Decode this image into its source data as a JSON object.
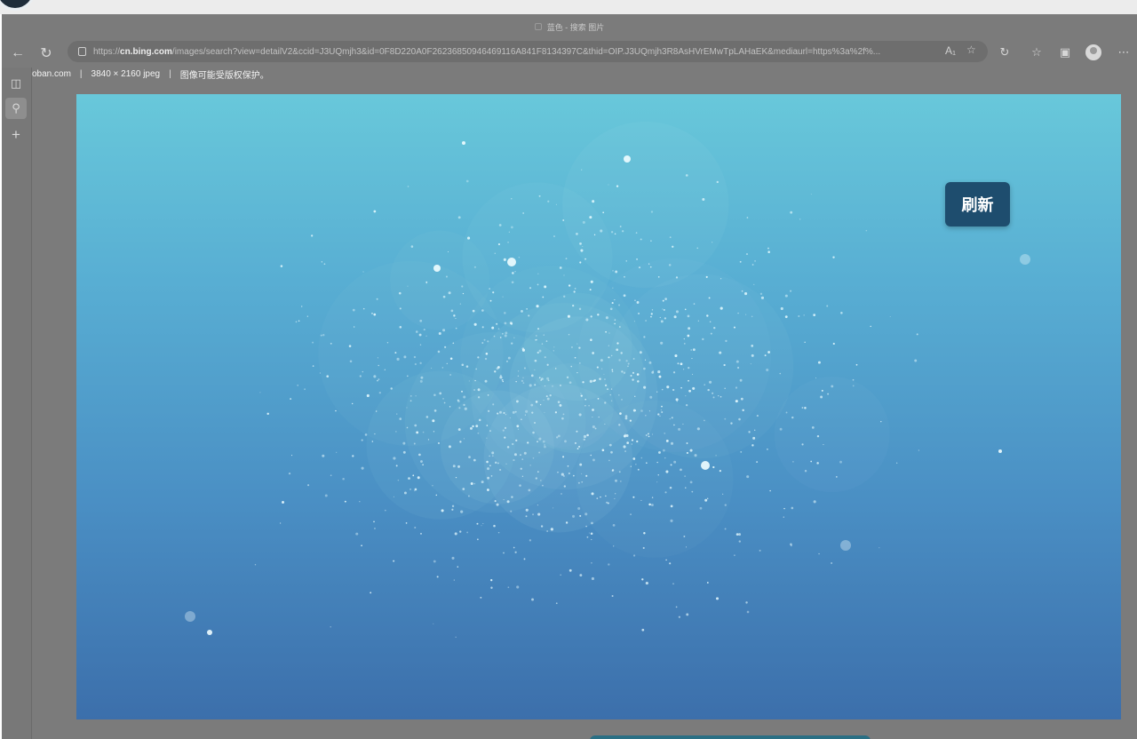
{
  "browser": {
    "tab_title": "蓝色 - 搜索 图片",
    "address": {
      "scheme": "https://",
      "host": "cn.bing.com",
      "path": "/images/search?view=detailV2&ccid=J3UQmjh3&id=0F8D220A0F26236850946469116A841F8134397C&thid=OIP.J3UQmjh3R8AsHVrEMwTpLAHaEK&mediaurl=https%3a%2f%..."
    },
    "icons": {
      "back": "back-arrow-icon",
      "refresh": "refresh-icon",
      "lock": "lock-icon",
      "read_aloud": "read-aloud-icon",
      "favorite_add": "add-favorite-icon",
      "copilot": "copilot-icon",
      "favorites": "favorites-icon",
      "collections": "collections-icon",
      "profile": "profile-icon",
      "more": "more-icon"
    }
  },
  "sidebar": {
    "icons": [
      "tab-actions-icon",
      "search-tab-icon",
      "new-tab-icon"
    ]
  },
  "page": {
    "source_site": "oban.com",
    "separator": "|",
    "dimensions": "3840 × 2160 jpeg",
    "copyright": "图像可能受版权保护。",
    "refresh_label": "刷新"
  },
  "colors": {
    "image_top": "#68c8da",
    "image_bottom": "#3c6fab",
    "refresh_button": "#1e4d6e"
  }
}
